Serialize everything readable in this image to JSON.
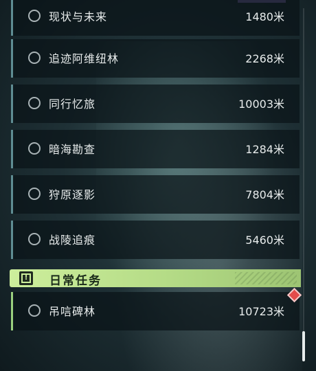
{
  "missions": [
    {
      "name": "现状与未来",
      "distance": "1480米"
    },
    {
      "name": "追迹阿维纽林",
      "distance": "2268米"
    },
    {
      "name": "同行忆旅",
      "distance": "10003米"
    },
    {
      "name": "暗海勘查",
      "distance": "1284米"
    },
    {
      "name": "狩原逐影",
      "distance": "7804米"
    },
    {
      "name": "战陵追痕",
      "distance": "5460米"
    }
  ],
  "daily_section": {
    "title": "日常任务",
    "icon": "exclamation-icon",
    "items": [
      {
        "name": "吊唁碑林",
        "distance": "10723米"
      }
    ]
  },
  "colors": {
    "row_accent": "#5f8d93",
    "daily_accent": "#b4db86",
    "marker": "#e34b4b"
  }
}
